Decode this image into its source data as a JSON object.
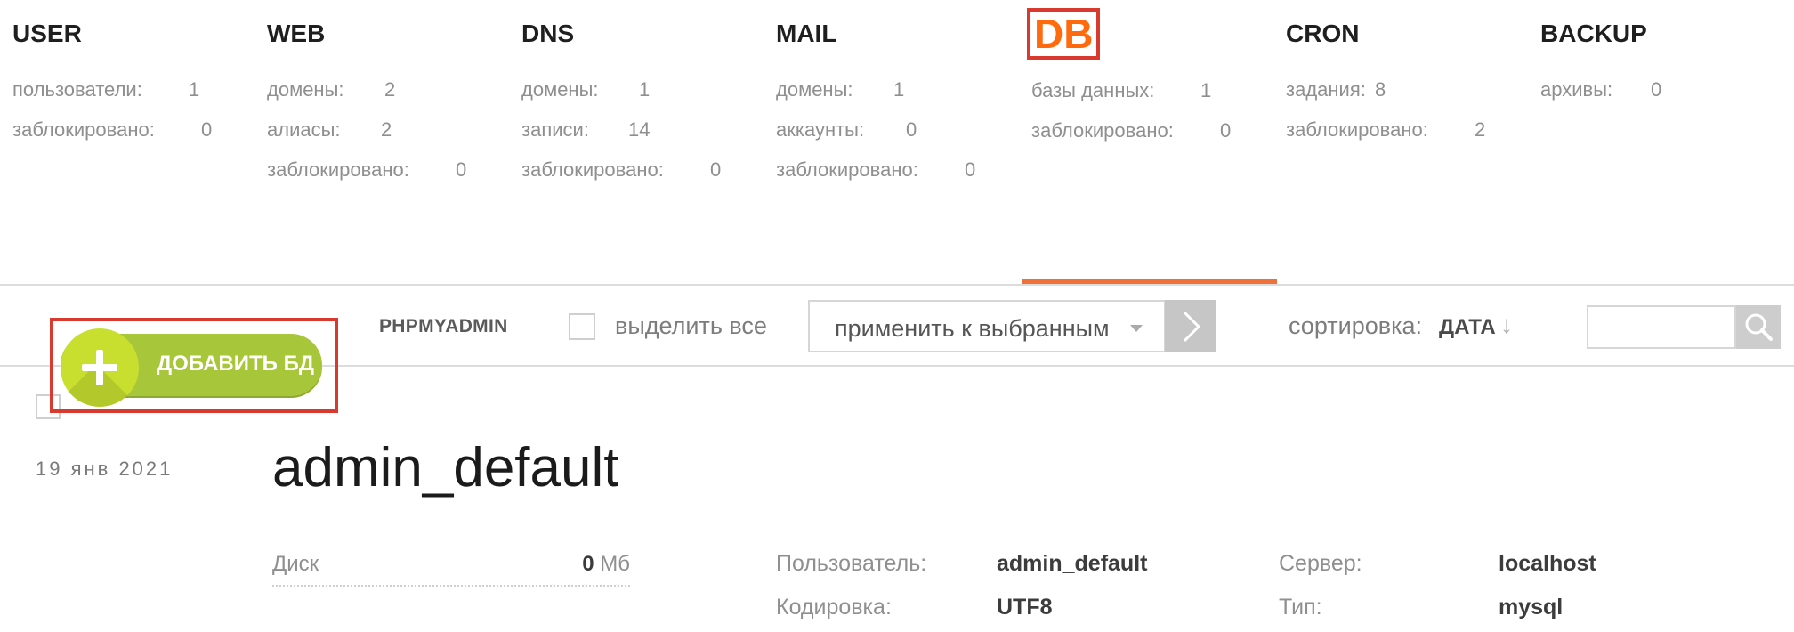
{
  "stats": [
    {
      "title": "USER",
      "rows": [
        {
          "label": "пользователи:",
          "value": "1"
        },
        {
          "label": "заблокировано:",
          "value": "0"
        }
      ]
    },
    {
      "title": "WEB",
      "rows": [
        {
          "label": "домены:",
          "value": "2"
        },
        {
          "label": "алиасы:",
          "value": "2"
        },
        {
          "label": "заблокировано:",
          "value": "0"
        }
      ]
    },
    {
      "title": "DNS",
      "rows": [
        {
          "label": "домены:",
          "value": "1"
        },
        {
          "label": "записи:",
          "value": "14"
        },
        {
          "label": "заблокировано:",
          "value": "0"
        }
      ]
    },
    {
      "title": "MAIL",
      "rows": [
        {
          "label": "домены:",
          "value": "1"
        },
        {
          "label": "аккаунты:",
          "value": "0"
        },
        {
          "label": "заблокировано:",
          "value": "0"
        }
      ]
    },
    {
      "title": "DB",
      "rows": [
        {
          "label": "базы данных:",
          "value": "1"
        },
        {
          "label": "заблокировано:",
          "value": "0"
        }
      ]
    },
    {
      "title": "CRON",
      "rows": [
        {
          "label": "задания:",
          "value": "8"
        },
        {
          "label": "заблокировано:",
          "value": "2"
        }
      ]
    },
    {
      "title": "BACKUP",
      "rows": [
        {
          "label": "архивы:",
          "value": "0"
        }
      ]
    }
  ],
  "toolbar": {
    "add_label": "ДОБАВИТЬ БД",
    "phpmyadmin_label": "PHPMYADMIN",
    "select_all_label": "выделить все",
    "bulk_action": "применить к выбранным",
    "sort_label": "сортировка:",
    "sort_value": "ДАТА",
    "sort_arrow": "↓",
    "search_value": ""
  },
  "database": {
    "date": "19  янв  2021",
    "name": "admin_default",
    "disk_label": "Диск",
    "disk_value": "0",
    "disk_unit": " Мб",
    "user_label": "Пользователь:",
    "user_value": "admin_default",
    "encoding_label": "Кодировка:",
    "encoding_value": "UTF8",
    "server_label": "Сервер:",
    "server_value": "localhost",
    "type_label": "Тип:",
    "type_value": "mysql"
  },
  "colors": {
    "accent": "#f0703a",
    "db_highlight": "#ff6a0d",
    "annotation_box": "#d83a2f",
    "add_button": "#a8c63a"
  }
}
